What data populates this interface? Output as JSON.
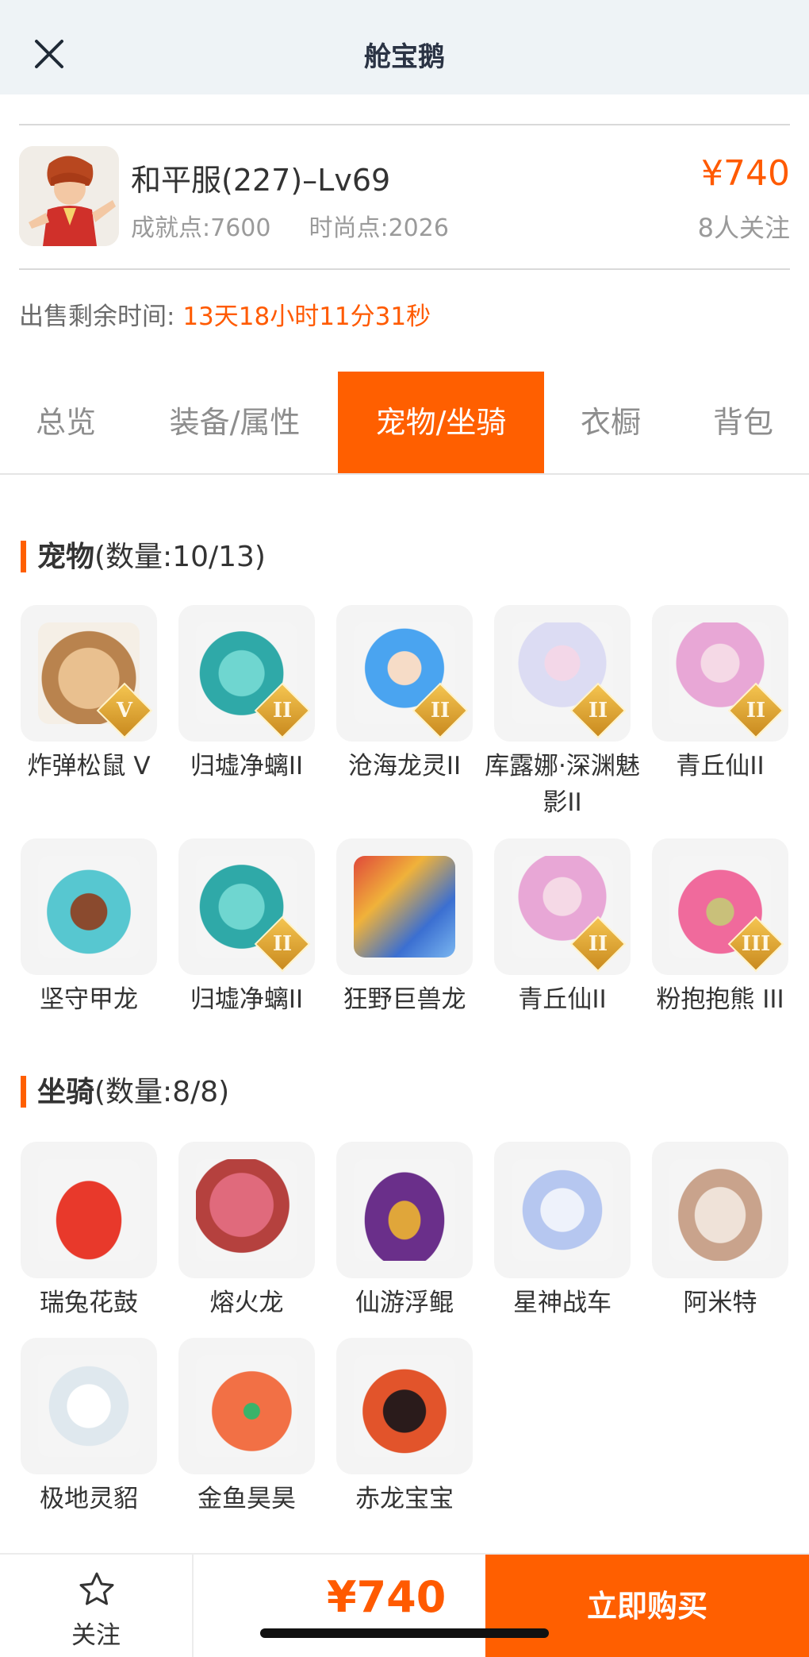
{
  "header": {
    "title": "舱宝鹅"
  },
  "character": {
    "name": "和平服(227)–Lv69",
    "achievement": "成就点:7600",
    "fashion": "时尚点:2026",
    "price": "¥740",
    "followers": "8人关注"
  },
  "sale": {
    "label": "出售剩余时间:",
    "countdown": "13天18小时11分31秒"
  },
  "tabs": [
    {
      "label": "总览"
    },
    {
      "label": "装备/属性"
    },
    {
      "label": "宠物/坐骑"
    },
    {
      "label": "衣橱"
    },
    {
      "label": "背包"
    }
  ],
  "active_tab": "宠物/坐骑",
  "pets": {
    "title": "宠物",
    "count": "(数量:10/13)",
    "items": [
      {
        "name": "炸弹松鼠 V",
        "badge": "V"
      },
      {
        "name": "归墟净螭II",
        "badge": "II"
      },
      {
        "name": "沧海龙灵II",
        "badge": "II"
      },
      {
        "name": "库露娜·深渊魅影II",
        "badge": "II"
      },
      {
        "name": "青丘仙II",
        "badge": "II"
      },
      {
        "name": "坚守甲龙",
        "badge": ""
      },
      {
        "name": "归墟净螭II",
        "badge": "II"
      },
      {
        "name": "狂野巨兽龙",
        "badge": ""
      },
      {
        "name": "青丘仙II",
        "badge": "II"
      },
      {
        "name": "粉抱抱熊 III",
        "badge": "III"
      }
    ]
  },
  "mounts": {
    "title": "坐骑",
    "count": "(数量:8/8)",
    "items": [
      {
        "name": "瑞兔花鼓"
      },
      {
        "name": "熔火龙"
      },
      {
        "name": "仙游浮鲲"
      },
      {
        "name": "星神战车"
      },
      {
        "name": "阿米特"
      },
      {
        "name": "极地灵貂"
      },
      {
        "name": "金鱼昊昊"
      },
      {
        "name": "赤龙宝宝"
      }
    ]
  },
  "bottom": {
    "follow_label": "关注",
    "price": "¥740",
    "buy_label": "立即购买"
  },
  "colors": {
    "accent": "#ff5f00",
    "price": "#ff5a00",
    "header_bg": "#eef3f6"
  }
}
